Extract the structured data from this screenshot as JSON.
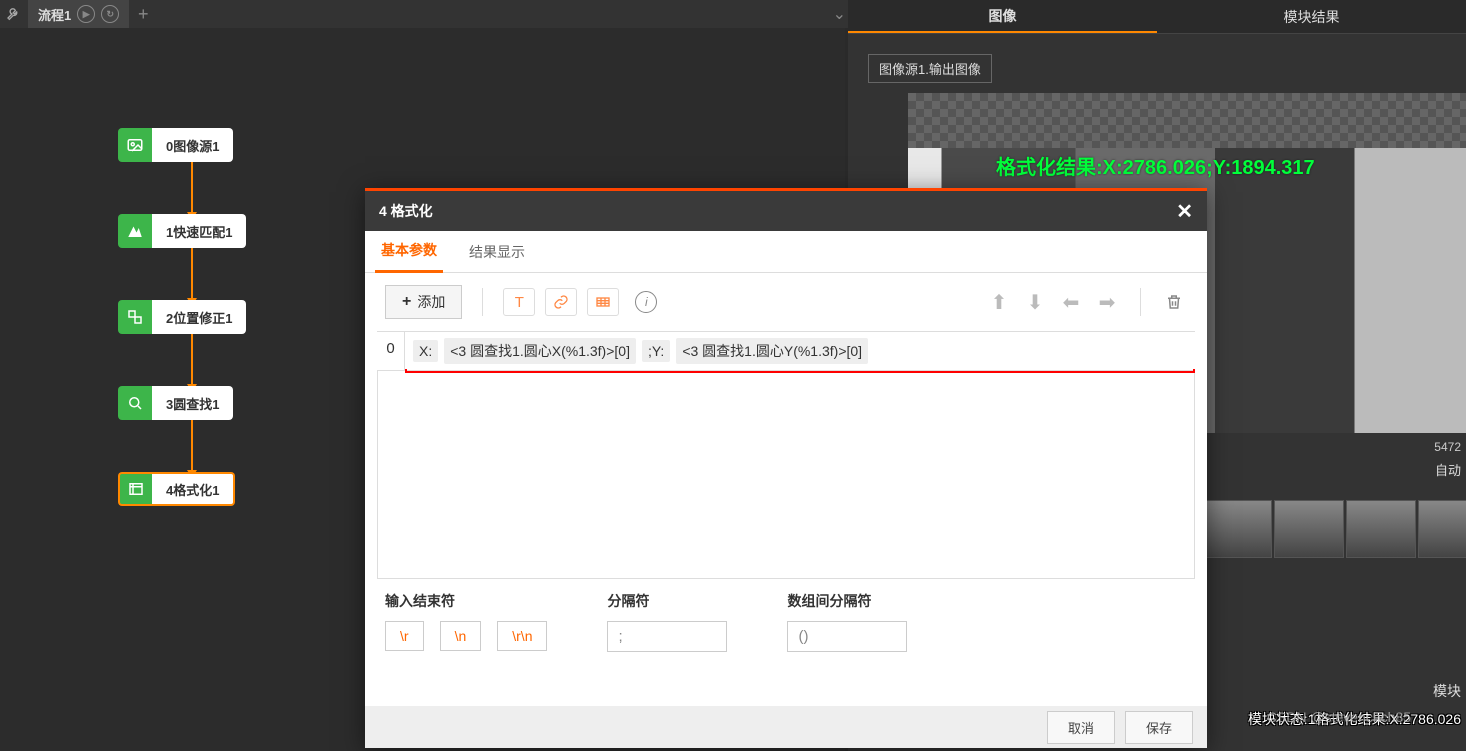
{
  "topbar": {
    "tabLabel": "流程1",
    "plus": "+"
  },
  "nodes": [
    {
      "label": "0图像源1"
    },
    {
      "label": "1快速匹配1"
    },
    {
      "label": "2位置修正1"
    },
    {
      "label": "3圆查找1"
    },
    {
      "label": "4格式化1"
    }
  ],
  "rpanel": {
    "tabs": {
      "image": "图像",
      "module": "模块结果"
    },
    "sourceSelect": "图像源1.输出图像",
    "overlay": "格式化结果:X:2786.026;Y:1894.317",
    "num": "5472",
    "auto": "自动",
    "modLabel": "模块",
    "status": "模块状态:1格式化结果:X:2786.026",
    "watermark": "CSDN @stevenchch85"
  },
  "dialog": {
    "title": "4 格式化",
    "tabs": {
      "basic": "基本参数",
      "result": "结果显示"
    },
    "addBtn": "添加",
    "row": {
      "index": "0",
      "labelX": "X:",
      "refX": "<3 圆查找1.圆心X(%1.3f)>[0]",
      "labelY": ";Y:",
      "refY": "<3 圆查找1.圆心Y(%1.3f)>[0]"
    },
    "opts": {
      "terminator": {
        "label": "输入结束符",
        "r": "\\r",
        "n": "\\n",
        "rn": "\\r\\n"
      },
      "separator": {
        "label": "分隔符",
        "value": ";"
      },
      "arraySep": {
        "label": "数组间分隔符",
        "value": "()"
      }
    },
    "footer": {
      "cancel": "取消",
      "save": "保存"
    }
  }
}
